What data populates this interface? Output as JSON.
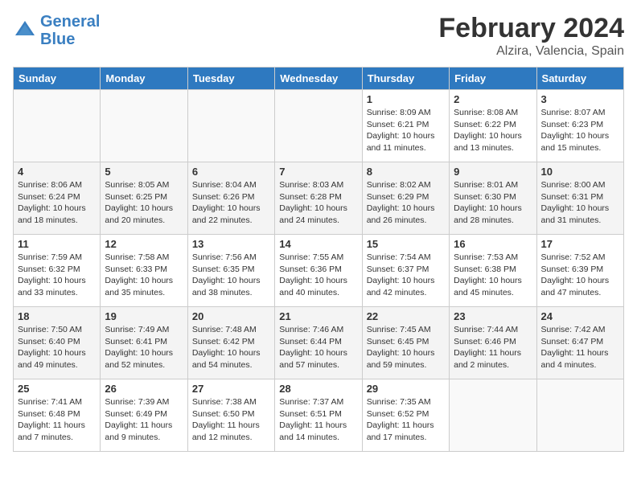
{
  "header": {
    "logo_line1": "General",
    "logo_line2": "Blue",
    "month_year": "February 2024",
    "location": "Alzira, Valencia, Spain"
  },
  "weekdays": [
    "Sunday",
    "Monday",
    "Tuesday",
    "Wednesday",
    "Thursday",
    "Friday",
    "Saturday"
  ],
  "weeks": [
    [
      {
        "day": "",
        "info": ""
      },
      {
        "day": "",
        "info": ""
      },
      {
        "day": "",
        "info": ""
      },
      {
        "day": "",
        "info": ""
      },
      {
        "day": "1",
        "info": "Sunrise: 8:09 AM\nSunset: 6:21 PM\nDaylight: 10 hours\nand 11 minutes."
      },
      {
        "day": "2",
        "info": "Sunrise: 8:08 AM\nSunset: 6:22 PM\nDaylight: 10 hours\nand 13 minutes."
      },
      {
        "day": "3",
        "info": "Sunrise: 8:07 AM\nSunset: 6:23 PM\nDaylight: 10 hours\nand 15 minutes."
      }
    ],
    [
      {
        "day": "4",
        "info": "Sunrise: 8:06 AM\nSunset: 6:24 PM\nDaylight: 10 hours\nand 18 minutes."
      },
      {
        "day": "5",
        "info": "Sunrise: 8:05 AM\nSunset: 6:25 PM\nDaylight: 10 hours\nand 20 minutes."
      },
      {
        "day": "6",
        "info": "Sunrise: 8:04 AM\nSunset: 6:26 PM\nDaylight: 10 hours\nand 22 minutes."
      },
      {
        "day": "7",
        "info": "Sunrise: 8:03 AM\nSunset: 6:28 PM\nDaylight: 10 hours\nand 24 minutes."
      },
      {
        "day": "8",
        "info": "Sunrise: 8:02 AM\nSunset: 6:29 PM\nDaylight: 10 hours\nand 26 minutes."
      },
      {
        "day": "9",
        "info": "Sunrise: 8:01 AM\nSunset: 6:30 PM\nDaylight: 10 hours\nand 28 minutes."
      },
      {
        "day": "10",
        "info": "Sunrise: 8:00 AM\nSunset: 6:31 PM\nDaylight: 10 hours\nand 31 minutes."
      }
    ],
    [
      {
        "day": "11",
        "info": "Sunrise: 7:59 AM\nSunset: 6:32 PM\nDaylight: 10 hours\nand 33 minutes."
      },
      {
        "day": "12",
        "info": "Sunrise: 7:58 AM\nSunset: 6:33 PM\nDaylight: 10 hours\nand 35 minutes."
      },
      {
        "day": "13",
        "info": "Sunrise: 7:56 AM\nSunset: 6:35 PM\nDaylight: 10 hours\nand 38 minutes."
      },
      {
        "day": "14",
        "info": "Sunrise: 7:55 AM\nSunset: 6:36 PM\nDaylight: 10 hours\nand 40 minutes."
      },
      {
        "day": "15",
        "info": "Sunrise: 7:54 AM\nSunset: 6:37 PM\nDaylight: 10 hours\nand 42 minutes."
      },
      {
        "day": "16",
        "info": "Sunrise: 7:53 AM\nSunset: 6:38 PM\nDaylight: 10 hours\nand 45 minutes."
      },
      {
        "day": "17",
        "info": "Sunrise: 7:52 AM\nSunset: 6:39 PM\nDaylight: 10 hours\nand 47 minutes."
      }
    ],
    [
      {
        "day": "18",
        "info": "Sunrise: 7:50 AM\nSunset: 6:40 PM\nDaylight: 10 hours\nand 49 minutes."
      },
      {
        "day": "19",
        "info": "Sunrise: 7:49 AM\nSunset: 6:41 PM\nDaylight: 10 hours\nand 52 minutes."
      },
      {
        "day": "20",
        "info": "Sunrise: 7:48 AM\nSunset: 6:42 PM\nDaylight: 10 hours\nand 54 minutes."
      },
      {
        "day": "21",
        "info": "Sunrise: 7:46 AM\nSunset: 6:44 PM\nDaylight: 10 hours\nand 57 minutes."
      },
      {
        "day": "22",
        "info": "Sunrise: 7:45 AM\nSunset: 6:45 PM\nDaylight: 10 hours\nand 59 minutes."
      },
      {
        "day": "23",
        "info": "Sunrise: 7:44 AM\nSunset: 6:46 PM\nDaylight: 11 hours\nand 2 minutes."
      },
      {
        "day": "24",
        "info": "Sunrise: 7:42 AM\nSunset: 6:47 PM\nDaylight: 11 hours\nand 4 minutes."
      }
    ],
    [
      {
        "day": "25",
        "info": "Sunrise: 7:41 AM\nSunset: 6:48 PM\nDaylight: 11 hours\nand 7 minutes."
      },
      {
        "day": "26",
        "info": "Sunrise: 7:39 AM\nSunset: 6:49 PM\nDaylight: 11 hours\nand 9 minutes."
      },
      {
        "day": "27",
        "info": "Sunrise: 7:38 AM\nSunset: 6:50 PM\nDaylight: 11 hours\nand 12 minutes."
      },
      {
        "day": "28",
        "info": "Sunrise: 7:37 AM\nSunset: 6:51 PM\nDaylight: 11 hours\nand 14 minutes."
      },
      {
        "day": "29",
        "info": "Sunrise: 7:35 AM\nSunset: 6:52 PM\nDaylight: 11 hours\nand 17 minutes."
      },
      {
        "day": "",
        "info": ""
      },
      {
        "day": "",
        "info": ""
      }
    ]
  ]
}
